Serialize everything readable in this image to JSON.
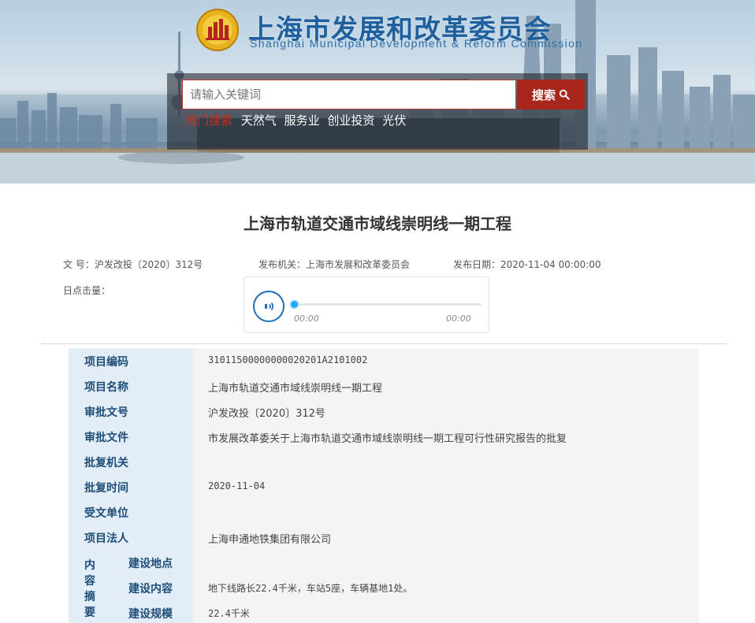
{
  "header": {
    "site_title": "上海市发展和改革委员会",
    "site_subtitle": "Shanghai Municipal Development & Reform Commission",
    "colors": {
      "brand_blue": "#1f5f9e",
      "search_red": "#a8261c",
      "hot_red": "#d12a1c"
    }
  },
  "search": {
    "placeholder": "请输入关键词",
    "button_label": "搜索",
    "button_icon": "search-icon",
    "hot_label": "热门搜索",
    "hot_keywords": [
      "天然气",
      "服务业",
      "创业投资",
      "光伏"
    ]
  },
  "article": {
    "title": "上海市轨道交通市域线崇明线一期工程",
    "doc_number_label": "文 号：",
    "doc_number": "沪发改投〔2020〕312号",
    "issuer_label": "发布机关：",
    "issuer": "上海市发展和改革委员会",
    "date_label": "发布日期：",
    "date": "2020-11-04 00:00:00",
    "listen_label": "日点击量："
  },
  "player": {
    "icon": "speaker-icon",
    "current_time": "00:00",
    "total_time": "00:00",
    "progress": 0
  },
  "table": {
    "rows": [
      {
        "label": "项目编码",
        "value": "31011500000000020201A2101002"
      },
      {
        "label": "项目名称",
        "value": "上海市轨道交通市域线崇明线一期工程"
      },
      {
        "label": "审批文号",
        "value": "沪发改投〔2020〕312号"
      },
      {
        "label": "审批文件",
        "value": "市发展改革委关于上海市轨道交通市域线崇明线一期工程可行性研究报告的批复"
      },
      {
        "label": "批复机关",
        "value": ""
      },
      {
        "label": "批复时间",
        "value": "2020-11-04"
      },
      {
        "label": "受文单位",
        "value": ""
      },
      {
        "label": "项目法人",
        "value": "上海申通地铁集团有限公司"
      }
    ],
    "summary_label": "内容摘要",
    "summary_rows": [
      {
        "label": "建设地点",
        "value": ""
      },
      {
        "label": "建设内容",
        "value": "地下线路长22.4千米，车站5座，车辆基地1处。"
      },
      {
        "label": "建设规模",
        "value": "22.4千米"
      }
    ]
  }
}
